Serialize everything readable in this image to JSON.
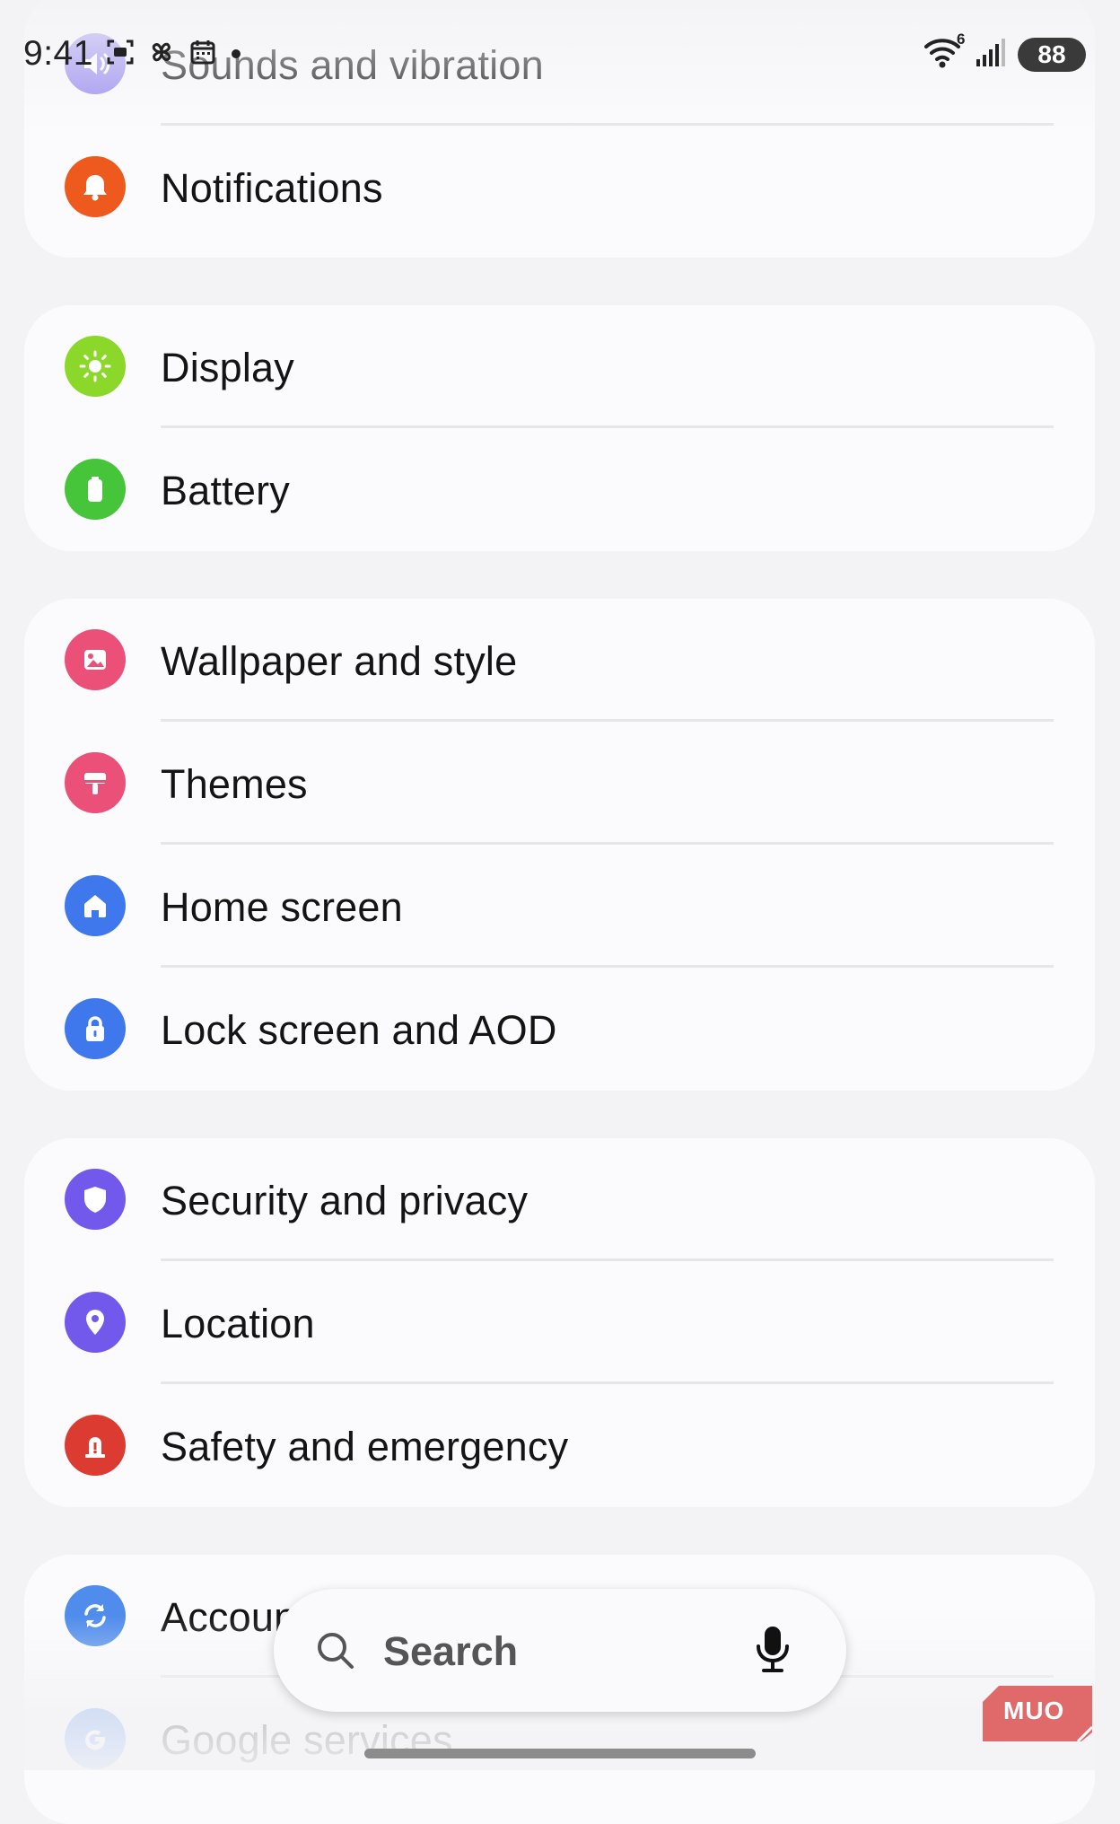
{
  "status_bar": {
    "time": "9:41",
    "network_type": "6",
    "battery_level": "88",
    "notification_icons": [
      "screenshot-icon",
      "pinwheel-icon",
      "calendar-icon",
      "dot-icon"
    ],
    "system_icons": [
      "wifi-icon",
      "signal-icon",
      "battery-icon"
    ]
  },
  "settings": {
    "groups": [
      {
        "items": [
          {
            "label": "Sounds and vibration",
            "icon": "speaker-icon",
            "color": "#9b8df0"
          },
          {
            "label": "Notifications",
            "icon": "bell-icon",
            "color": "#ee5a1e"
          }
        ]
      },
      {
        "items": [
          {
            "label": "Display",
            "icon": "sun-icon",
            "color": "#8bd82a"
          },
          {
            "label": "Battery",
            "icon": "battery-icon",
            "color": "#46c53a"
          }
        ]
      },
      {
        "items": [
          {
            "label": "Wallpaper and style",
            "icon": "image-icon",
            "color": "#ea5078"
          },
          {
            "label": "Themes",
            "icon": "paintbrush-icon",
            "color": "#ea5078"
          },
          {
            "label": "Home screen",
            "icon": "home-icon",
            "color": "#3e78ec"
          },
          {
            "label": "Lock screen and AOD",
            "icon": "lock-icon",
            "color": "#3e78ec"
          }
        ]
      },
      {
        "items": [
          {
            "label": "Security and privacy",
            "icon": "shield-icon",
            "color": "#7259ec"
          },
          {
            "label": "Location",
            "icon": "pin-icon",
            "color": "#7259ec"
          },
          {
            "label": "Safety and emergency",
            "icon": "siren-icon",
            "color": "#dc3b32"
          }
        ]
      },
      {
        "items": [
          {
            "label": "Accounts and backup",
            "icon": "sync-icon",
            "color": "#4f8cec"
          },
          {
            "label": "Google services",
            "icon": "google-icon",
            "color": "#4f8cec"
          }
        ]
      }
    ]
  },
  "search": {
    "label": "Search",
    "mic_icon": "mic-icon"
  },
  "watermark": {
    "text": "MUO",
    "color": "#e06a6a"
  }
}
